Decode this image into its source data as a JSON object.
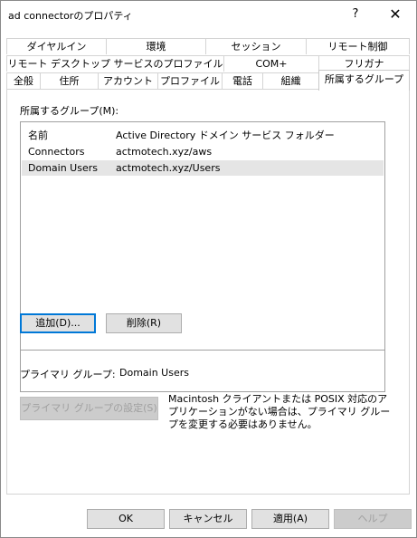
{
  "window": {
    "title": "ad connectorのプロパティ",
    "help_symbol": "?",
    "close_symbol": "✕"
  },
  "tabs": {
    "row1": [
      "ダイヤルイン",
      "環境",
      "セッション",
      "リモート制御"
    ],
    "row2": [
      "リモート デスクトップ サービスのプロファイル",
      "COM+",
      "フリガナ"
    ],
    "row3": [
      "全般",
      "住所",
      "アカウント",
      "プロファイル",
      "電話",
      "組織",
      "所属するグループ"
    ],
    "active": "所属するグループ"
  },
  "groups": {
    "label": "所属するグループ(M):",
    "columns": [
      "名前",
      "Active Directory ドメイン サービス フォルダー"
    ],
    "rows": [
      {
        "name": "Connectors",
        "folder": "actmotech.xyz/aws"
      },
      {
        "name": "Domain Users",
        "folder": "actmotech.xyz/Users"
      }
    ],
    "add_label": "追加(D)...",
    "remove_label": "削除(R)"
  },
  "primary": {
    "label": "プライマリ グループ:",
    "value": "Domain Users",
    "set_label": "プライマリ グループの設定(S)",
    "note": "Macintosh クライアントまたは POSIX 対応のアプリケーションがない場合は、プライマリ グループを変更する必要はありません。"
  },
  "footer": {
    "ok": "OK",
    "cancel": "キャンセル",
    "apply": "適用(A)",
    "help": "ヘルプ"
  }
}
